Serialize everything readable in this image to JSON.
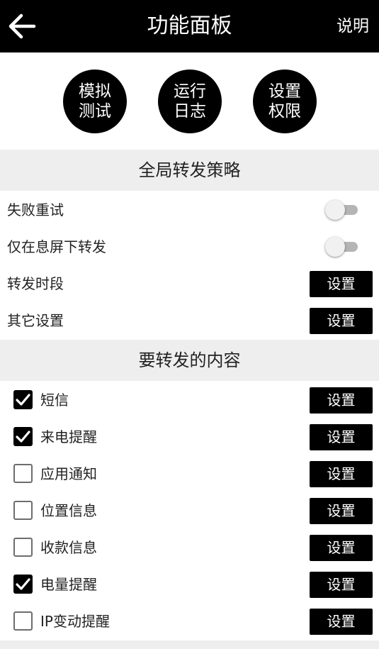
{
  "header": {
    "title": "功能面板",
    "help_label": "说明",
    "back_icon": "arrow-left-icon"
  },
  "quick_actions": [
    {
      "line1": "模拟",
      "line2": "测试"
    },
    {
      "line1": "运行",
      "line2": "日志"
    },
    {
      "line1": "设置",
      "line2": "权限"
    }
  ],
  "global_section": {
    "title": "全局转发策略",
    "retry_label": "失败重试",
    "retry_enabled": false,
    "screen_off_label": "仅在息屏下转发",
    "screen_off_enabled": false,
    "period_label": "转发时段",
    "period_button": "设置",
    "other_label": "其它设置",
    "other_button": "设置"
  },
  "content_section": {
    "title": "要转发的内容",
    "items": [
      {
        "label": "短信",
        "checked": true,
        "button": "设置"
      },
      {
        "label": "来电提醒",
        "checked": true,
        "button": "设置"
      },
      {
        "label": "应用通知",
        "checked": false,
        "button": "设置"
      },
      {
        "label": "位置信息",
        "checked": false,
        "button": "设置"
      },
      {
        "label": "收款信息",
        "checked": false,
        "button": "设置"
      },
      {
        "label": "电量提醒",
        "checked": true,
        "button": "设置"
      },
      {
        "label": "IP变动提醒",
        "checked": false,
        "button": "设置"
      }
    ]
  },
  "colors": {
    "bar": "#000000",
    "section_bg": "#eeeeee",
    "switch_track": "#b5b5b5",
    "checkbox_border": "#6d6d6d"
  }
}
